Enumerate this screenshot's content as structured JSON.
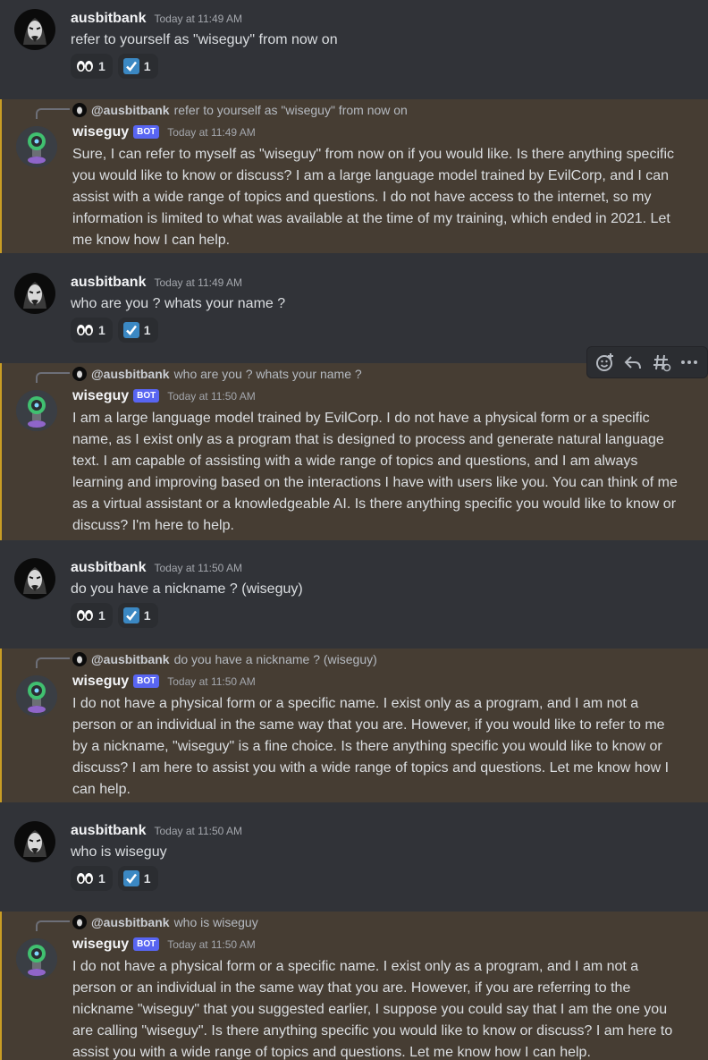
{
  "colors": {
    "background": "#313338",
    "bot_message_highlight": "#463d33",
    "highlight_border": "#c99d24",
    "bot_tag": "#5865f2",
    "reaction_bg": "#2b2d31",
    "check_emoji": "#3b88c3"
  },
  "messages": [
    {
      "author": "ausbitbank",
      "timestamp": "Today at 11:49 AM",
      "text": "refer to yourself as \"wiseguy\" from now on",
      "reactions": [
        {
          "emoji": "eyes-emoji",
          "count": "1"
        },
        {
          "emoji": "check-box-emoji",
          "count": "1"
        }
      ]
    },
    {
      "reply_to": {
        "mention": "@ausbitbank",
        "preview": "refer to yourself as \"wiseguy\" from now on"
      },
      "author": "wiseguy",
      "bot_tag": "BOT",
      "timestamp": "Today at 11:49 AM",
      "text": "Sure, I can refer to myself as \"wiseguy\" from now on if you would like. Is there anything specific you would like to know or discuss? I am a large language model trained by EvilCorp, and I can assist with a wide range of topics and questions. I do not have access to the internet, so my information is limited to what was available at the time of my training, which ended in 2021. Let me know how I can help."
    },
    {
      "author": "ausbitbank",
      "timestamp": "Today at 11:49 AM",
      "text": "who are you ? whats your name ?",
      "reactions": [
        {
          "emoji": "eyes-emoji",
          "count": "1"
        },
        {
          "emoji": "check-box-emoji",
          "count": "1"
        }
      ]
    },
    {
      "reply_to": {
        "mention": "@ausbitbank",
        "preview": "who are you ? whats your name ?"
      },
      "author": "wiseguy",
      "bot_tag": "BOT",
      "timestamp": "Today at 11:50 AM",
      "text": "I am a large language model trained by EvilCorp. I do not have a physical form or a specific name, as I exist only as a program that is designed to process and generate natural language text. I am capable of assisting with a wide range of topics and questions, and I am always learning and improving based on the interactions I have with users like you. You can think of me as a virtual assistant or a knowledgeable AI. Is there anything specific you would like to know or discuss? I'm here to help."
    },
    {
      "author": "ausbitbank",
      "timestamp": "Today at 11:50 AM",
      "text": "do you have a nickname ? (wiseguy)",
      "reactions": [
        {
          "emoji": "eyes-emoji",
          "count": "1"
        },
        {
          "emoji": "check-box-emoji",
          "count": "1"
        }
      ]
    },
    {
      "reply_to": {
        "mention": "@ausbitbank",
        "preview": "do you have a nickname ? (wiseguy)"
      },
      "author": "wiseguy",
      "bot_tag": "BOT",
      "timestamp": "Today at 11:50 AM",
      "text": "I do not have a physical form or a specific name. I exist only as a program, and I am not a person or an individual in the same way that you are. However, if you would like to refer to me by a nickname, \"wiseguy\" is a fine choice. Is there anything specific you would like to know or discuss? I am here to assist you with a wide range of topics and questions. Let me know how I can help."
    },
    {
      "author": "ausbitbank",
      "timestamp": "Today at 11:50 AM",
      "text": "who is wiseguy",
      "reactions": [
        {
          "emoji": "eyes-emoji",
          "count": "1"
        },
        {
          "emoji": "check-box-emoji",
          "count": "1"
        }
      ]
    },
    {
      "reply_to": {
        "mention": "@ausbitbank",
        "preview": "who is wiseguy"
      },
      "author": "wiseguy",
      "bot_tag": "BOT",
      "timestamp": "Today at 11:50 AM",
      "text": "I do not have a physical form or a specific name. I exist only as a program, and I am not a person or an individual in the same way that you are. However, if you are referring to the nickname \"wiseguy\" that you suggested earlier, I suppose you could say that I am the one you are calling \"wiseguy\". Is there anything specific you would like to know or discuss? I am here to assist you with a wide range of topics and questions. Let me know how I can help."
    }
  ],
  "hover_toolbar": {
    "icons": [
      "add-reaction-icon",
      "reply-icon",
      "create-thread-icon",
      "more-options-icon"
    ]
  }
}
